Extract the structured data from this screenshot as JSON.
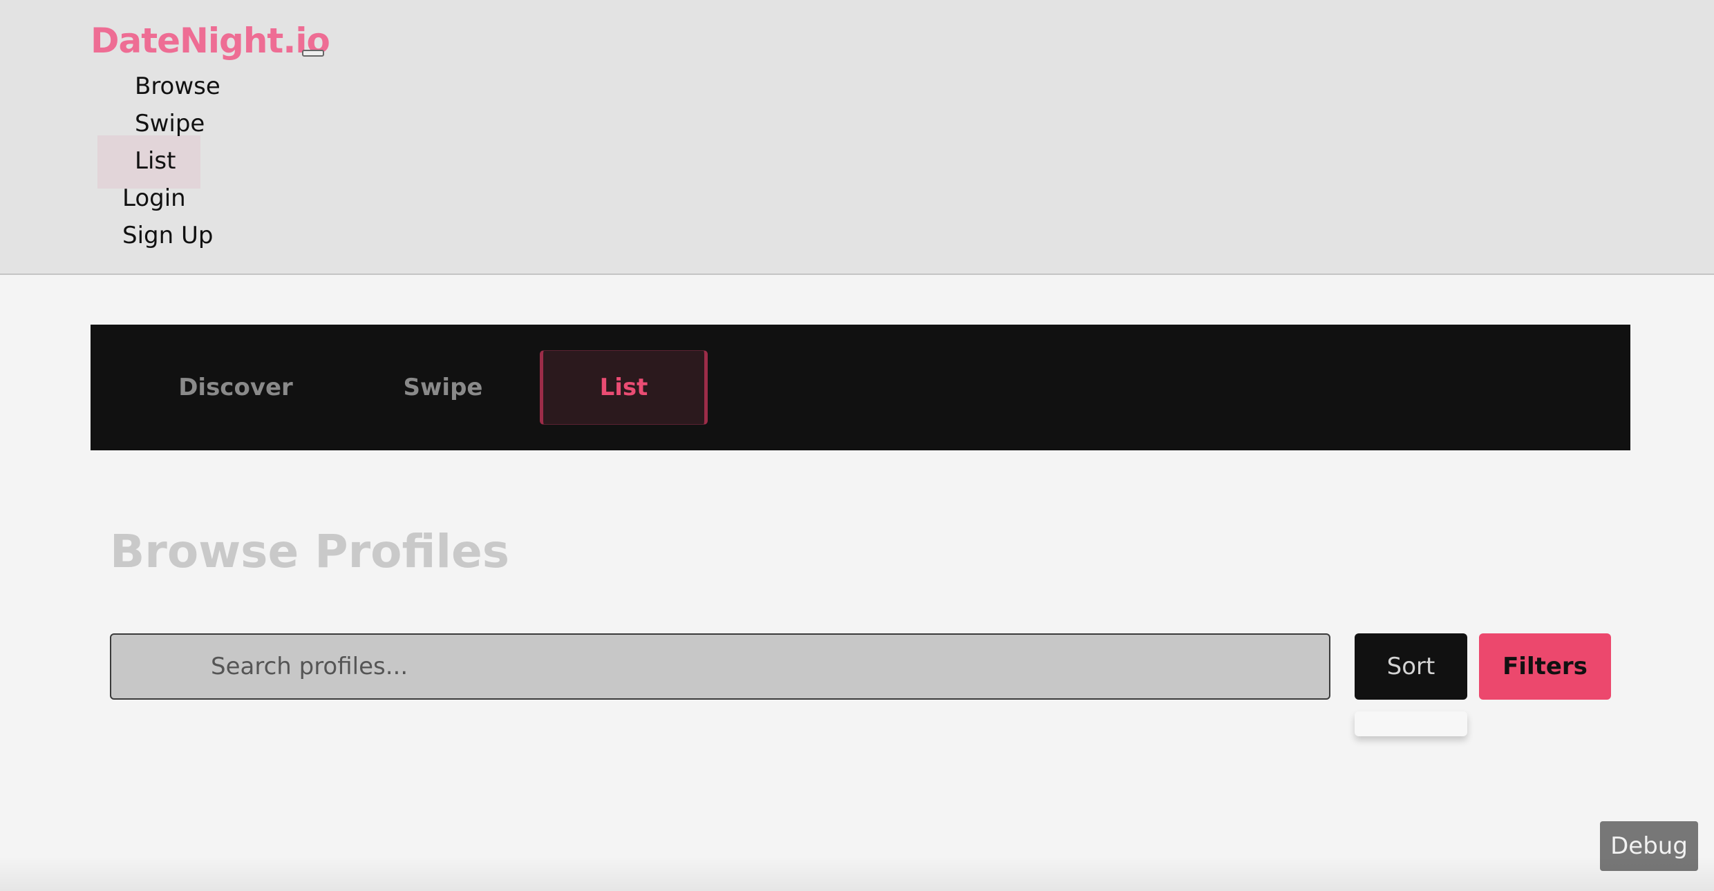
{
  "header": {
    "brand": "DateNight.io",
    "nav": {
      "browse": "Browse",
      "swipe": "Swipe",
      "list": "List",
      "login": "Login",
      "signup": "Sign Up"
    }
  },
  "tabs": {
    "discover": "Discover",
    "swipe": "Swipe",
    "list": "List",
    "active": "List"
  },
  "main": {
    "title": "Browse Profiles",
    "search": {
      "placeholder": "Search profiles...",
      "value": ""
    },
    "sort_label": "Sort",
    "filters_label": "Filters"
  },
  "debug_label": "Debug",
  "colors": {
    "brand": "#ee6d94",
    "accent": "#ec486d",
    "tab_bar": "#111111",
    "header_bg": "#e3e3e3"
  }
}
